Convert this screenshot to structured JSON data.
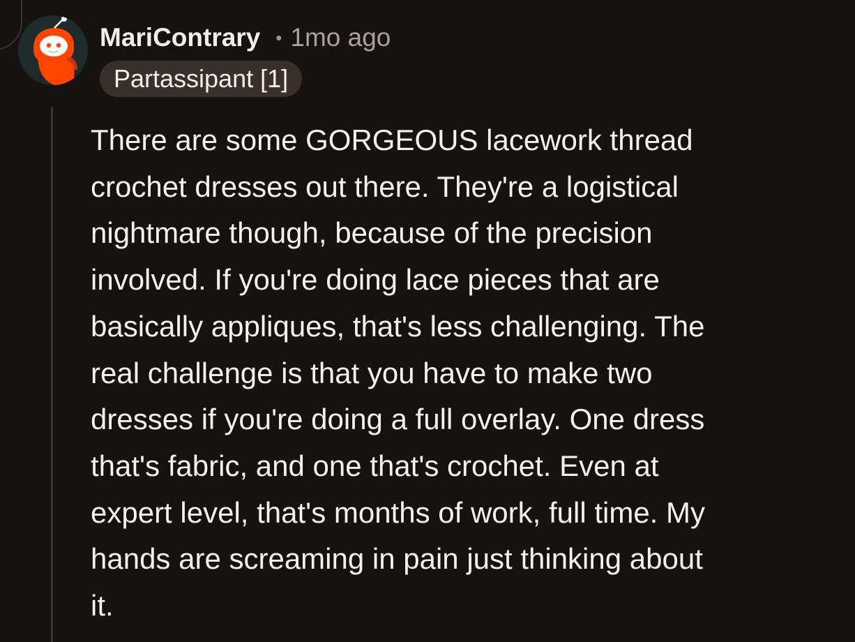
{
  "comment": {
    "username": "MariContrary",
    "separator": "•",
    "timestamp": "1mo ago",
    "flair": "Partassipant [1]",
    "body": "There are some GORGEOUS lacework thread\ncrochet dresses out there. They're a logistical\nnightmare though, because of the precision\ninvolved. If you're doing lace pieces that are\nbasically appliques, that's less challenging. The\nreal challenge is that you have to make two\ndresses if you're doing a full overlay. One dress\nthat's fabric, and one that's crochet. Even at\nexpert level, that's months of work, full time. My\nhands are screaming in pain just thinking about\nit.",
    "avatar_icon": "reddit-snoo-avatar"
  },
  "colors": {
    "background": "#161210",
    "text": "#f4f1ef",
    "muted": "#a8a19f",
    "flair_bg": "#3a302b",
    "avatar_accent": "#ff4500"
  }
}
